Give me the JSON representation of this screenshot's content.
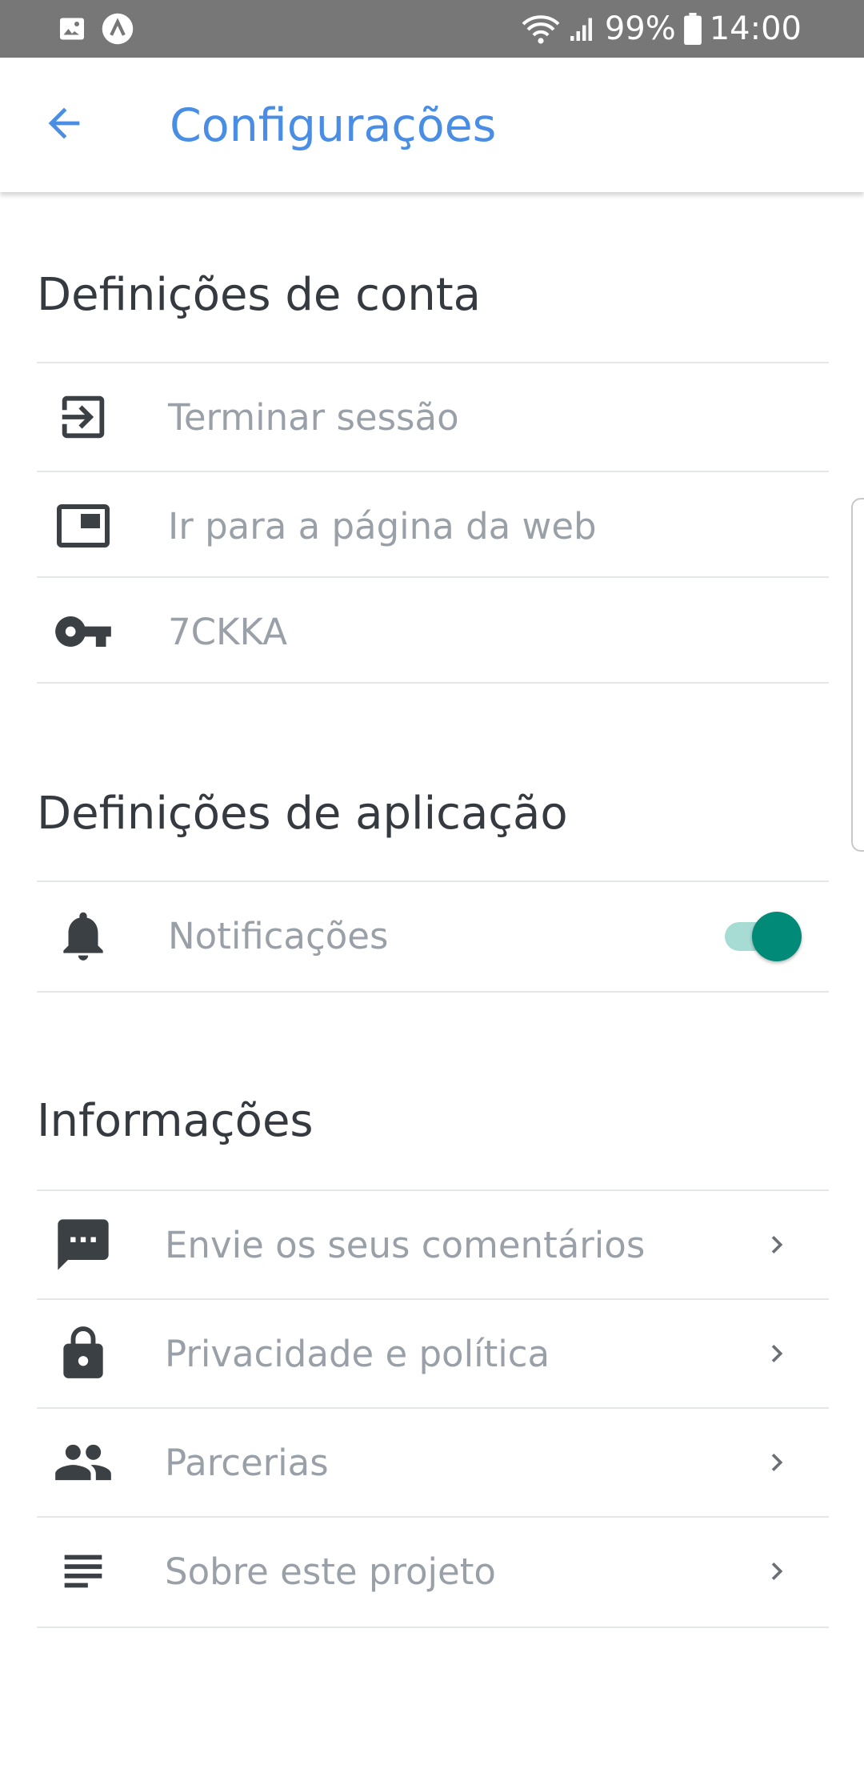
{
  "status_bar": {
    "battery": "99%",
    "time": "14:00"
  },
  "app_bar": {
    "title": "Configurações"
  },
  "sections": {
    "account": {
      "title": "Definições de conta",
      "items": [
        {
          "label": "Terminar sessão",
          "icon": "logout-icon"
        },
        {
          "label": "Ir para a página da web",
          "icon": "web-page-icon"
        },
        {
          "label": "7CKKA",
          "icon": "key-icon"
        }
      ]
    },
    "application": {
      "title": "Definições de aplicação",
      "items": [
        {
          "label": "Notificações",
          "icon": "bell-icon",
          "toggle_on": true
        }
      ]
    },
    "info": {
      "title": "Informações",
      "items": [
        {
          "label": "Envie os seus comentários",
          "icon": "feedback-icon"
        },
        {
          "label": "Privacidade e política",
          "icon": "lock-icon"
        },
        {
          "label": "Parcerias",
          "icon": "people-icon"
        },
        {
          "label": "Sobre este projeto",
          "icon": "notes-icon"
        }
      ]
    }
  },
  "colors": {
    "accent": "#4a8de5",
    "toggle_knob": "#028a78",
    "toggle_track": "#a7dcd4",
    "status_bar": "#777777"
  }
}
